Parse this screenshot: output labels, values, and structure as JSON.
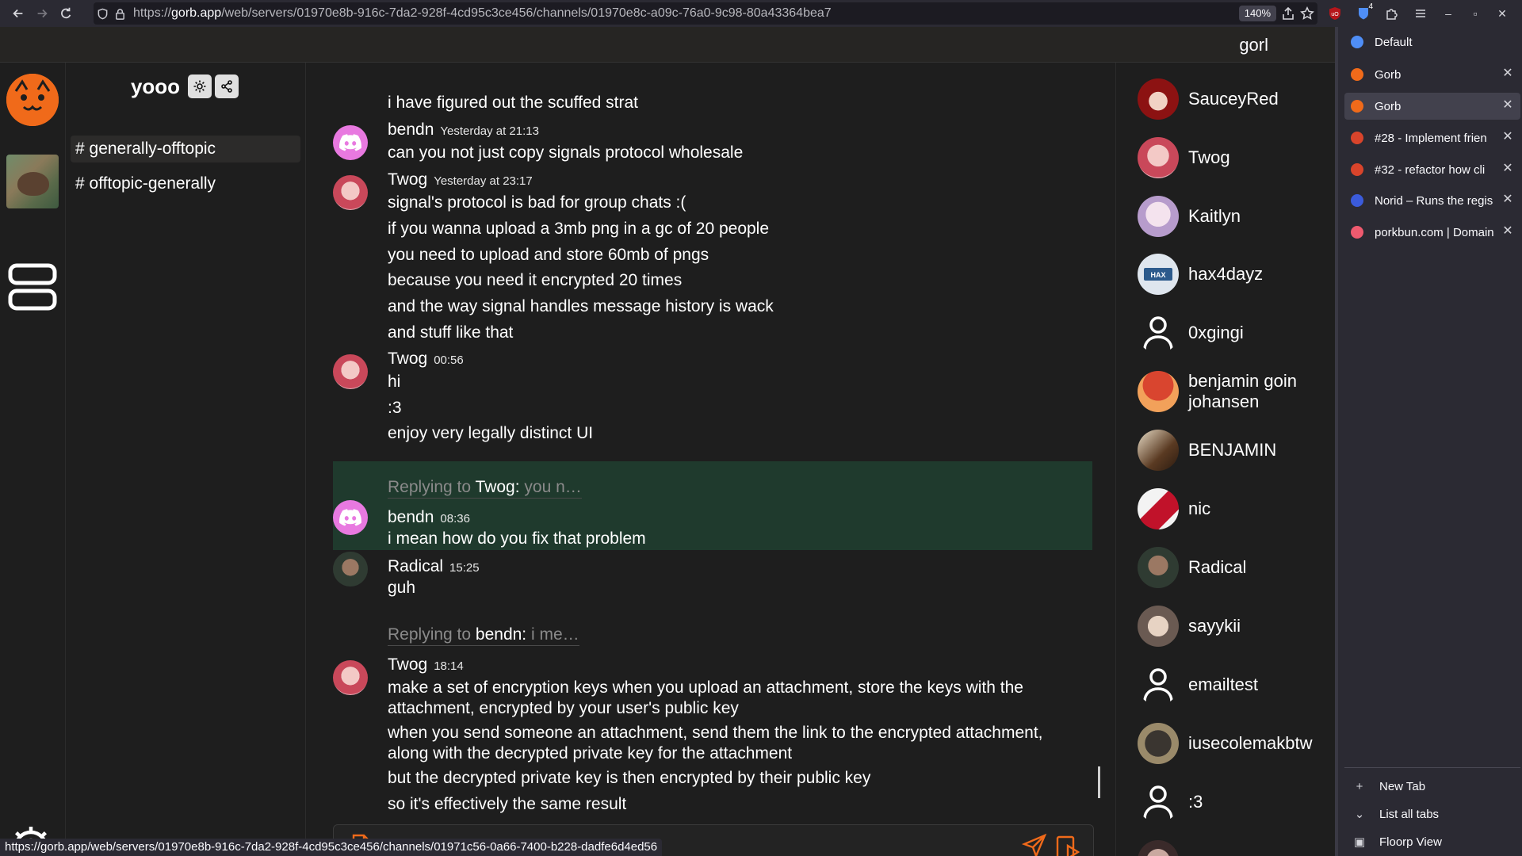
{
  "browser": {
    "url_prefix": "https://",
    "url_host": "gorb.app",
    "url_path": "/web/servers/01970e8b-916c-7da2-928f-4cd95c3ce456/channels/01970e8c-a09c-76a0-9c98-80a43364bea7",
    "zoom": "140%",
    "status_url": "https://gorb.app/web/servers/01970e8b-916c-7da2-928f-4cd95c3ce456/channels/01971c56-0a66-7400-b228-dadfe6d4ed56",
    "extension_badge": "4"
  },
  "app": {
    "top_query": "gorl",
    "server_name": "yooo",
    "channels": [
      {
        "label": "# generally-offtopic",
        "active": true
      },
      {
        "label": "# offtopic-generally",
        "active": false
      }
    ]
  },
  "messages": {
    "line_0": "i have figured out the scuffed strat",
    "m1": {
      "author": "bendn",
      "time": "Yesterday at 21:13",
      "lines": [
        "can you not just copy signals protocol wholesale"
      ]
    },
    "m2": {
      "author": "Twog",
      "time": "Yesterday at 23:17",
      "lines": [
        "signal's protocol is bad for group chats :(",
        "if you wanna upload a 3mb png in a gc of 20 people",
        "you need to upload and store 60mb of pngs",
        "because you need it encrypted 20 times",
        "and the way signal handles message history is wack",
        "and stuff like that"
      ]
    },
    "m3": {
      "author": "Twog",
      "time": "00:56",
      "lines": [
        "hi",
        ":3",
        "enjoy very legally distinct UI"
      ]
    },
    "m4": {
      "reply_prefix": "Replying to",
      "reply_to": "Twog:",
      "reply_snippet": "you n…",
      "author": "bendn",
      "time": "08:36",
      "lines": [
        "i mean how do you fix that problem"
      ]
    },
    "m5": {
      "author": "Radical",
      "time": "15:25",
      "lines": [
        "guh"
      ]
    },
    "m6": {
      "reply_prefix": "Replying to",
      "reply_to": "bendn:",
      "reply_snippet": "i me…",
      "author": "Twog",
      "time": "18:14",
      "lines": [
        "make a set of encryption keys when you upload an attachment, store the keys with the attachment, encrypted by your user's public key",
        "when you send someone an attachment, send them the link to the encrypted attachment, along with the decrypted private key for the attachment",
        "but the decrypted private key is then encrypted by their public key",
        "so it's effectively the same result"
      ]
    }
  },
  "members": [
    {
      "name": "SauceyRed",
      "avatar": "red-anime"
    },
    {
      "name": "Twog",
      "avatar": "twog"
    },
    {
      "name": "Kaitlyn",
      "avatar": "kaitlyn"
    },
    {
      "name": "hax4dayz",
      "avatar": "hax"
    },
    {
      "name": "0xgingi",
      "avatar": "generic-user-icon"
    },
    {
      "name": "benjamin goin johansen",
      "avatar": "tree"
    },
    {
      "name": "BENJAMIN",
      "avatar": "benjamin"
    },
    {
      "name": "nic",
      "avatar": "nic"
    },
    {
      "name": "Radical",
      "avatar": "radical"
    },
    {
      "name": "sayykii",
      "avatar": "sayykii"
    },
    {
      "name": "emailtest",
      "avatar": "generic-user-icon"
    },
    {
      "name": "iusecolemakbtw",
      "avatar": "cat"
    },
    {
      "name": ":3",
      "avatar": "generic-user-icon"
    }
  ],
  "tabs": [
    {
      "title": "Default",
      "favicon_color": "#4f8ef7",
      "closable": false,
      "active": false
    },
    {
      "title": "Gorb",
      "favicon_color": "#f06a1a",
      "closable": true,
      "active": false
    },
    {
      "title": "Gorb",
      "favicon_color": "#f06a1a",
      "closable": true,
      "active": true
    },
    {
      "title": "#28 - Implement frien",
      "favicon_color": "#d9442b",
      "closable": true,
      "active": false
    },
    {
      "title": "#32 - refactor how cli",
      "favicon_color": "#d9442b",
      "closable": true,
      "active": false
    },
    {
      "title": "Norid – Runs the regis",
      "favicon_color": "#3b5bdb",
      "closable": true,
      "active": false
    },
    {
      "title": "porkbun.com | Domain",
      "favicon_color": "#ef5a6f",
      "closable": true,
      "active": false
    }
  ],
  "sidebar_actions": {
    "new_tab": "New Tab",
    "list_all_tabs": "List all tabs",
    "floorp_view": "Floorp View"
  },
  "colors": {
    "accent": "#f06a1a",
    "reply_highlight": "#1f3a2d",
    "discord_avatar": "#e879e0"
  }
}
